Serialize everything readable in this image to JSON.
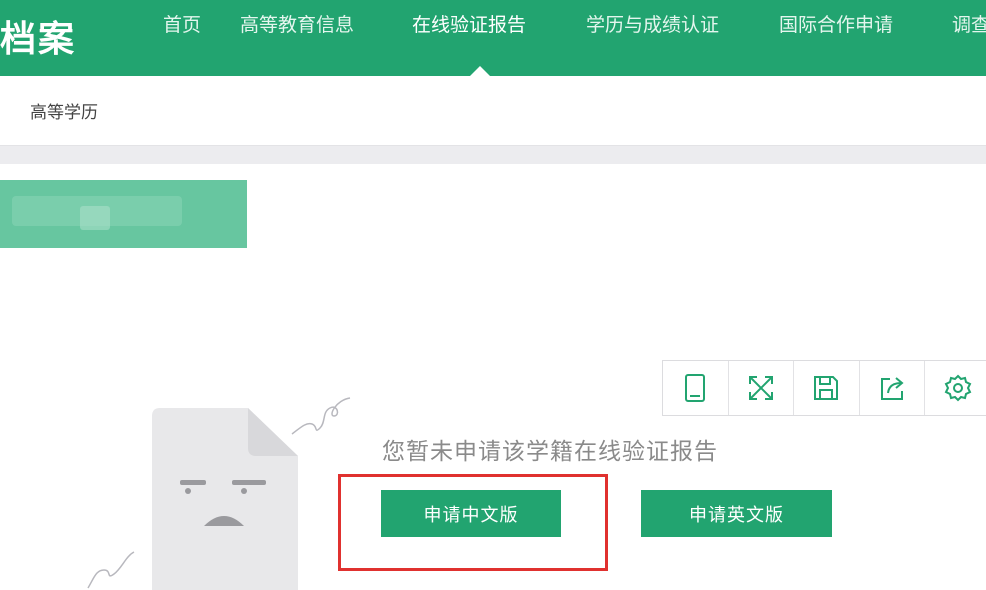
{
  "header": {
    "brand": "档案",
    "nav": [
      {
        "label": "首页"
      },
      {
        "label": "高等教育信息"
      },
      {
        "label": "在线验证报告",
        "active": true
      },
      {
        "label": "学历与成绩认证"
      },
      {
        "label": "国际合作申请"
      },
      {
        "label": "调查"
      }
    ]
  },
  "subnav": {
    "label": "高等学历"
  },
  "toolbar": {
    "icons": [
      "tablet-icon",
      "fullscreen-icon",
      "save-icon",
      "share-icon",
      "settings-icon"
    ]
  },
  "empty_state": {
    "message": "您暂未申请该学籍在线验证报告",
    "apply_cn_label": "申请中文版",
    "apply_en_label": "申请英文版"
  },
  "colors": {
    "brand_green": "#22a470",
    "highlight_red": "#e0312f",
    "muted_text": "#8a8a8a"
  }
}
